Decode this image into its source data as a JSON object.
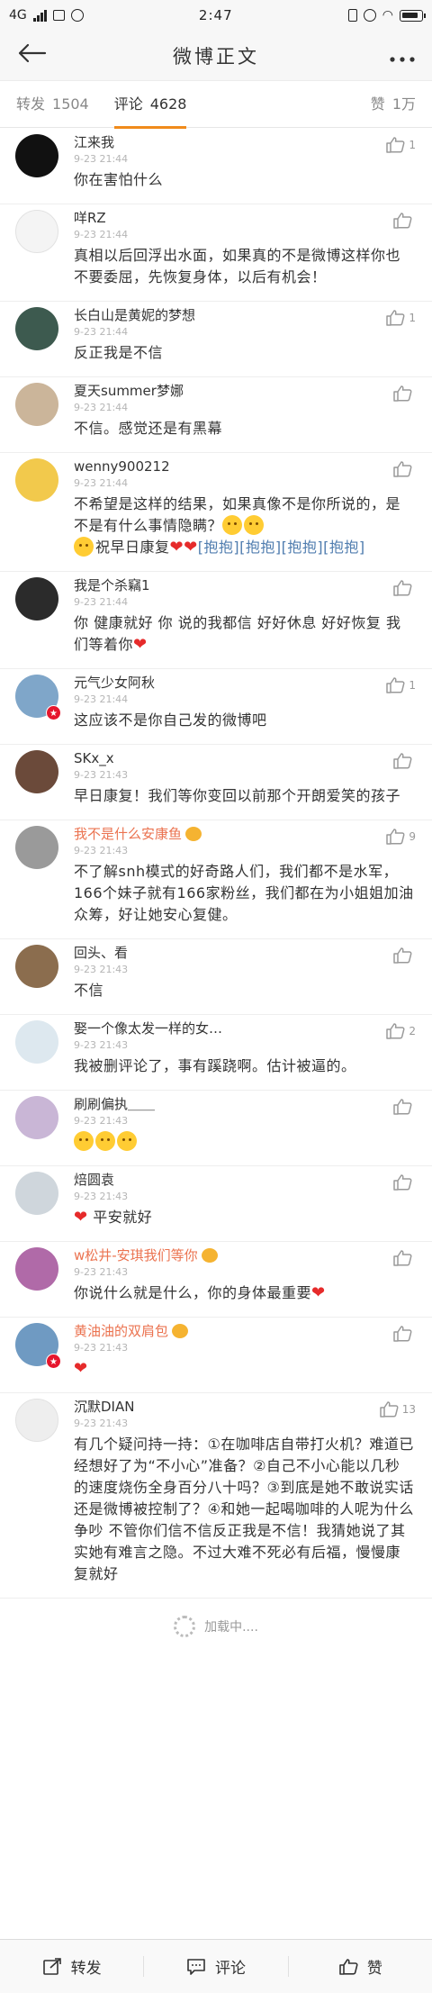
{
  "status_bar": {
    "network": "4G",
    "signal_text": "ıl",
    "time": "2:47",
    "battery": ""
  },
  "navbar": {
    "title": "微博正文"
  },
  "tabs": {
    "repost_label": "转发",
    "repost_count": "1504",
    "comment_label": "评论",
    "comment_count": "4628",
    "like_label": "赞",
    "like_count": "1万"
  },
  "comments": [
    {
      "name": "江来我",
      "time": "9-23 21:44",
      "text": "你在害怕什么",
      "likes": "1",
      "avatar_color": "#111111",
      "vip": false
    },
    {
      "name": "咩RZ",
      "time": "9-23 21:44",
      "text": "真相以后回浮出水面，如果真的不是微博这样你也不要委屈，先恢复身体，以后有机会！",
      "likes": "",
      "avatar_color": "#f4f4f4",
      "vip": false
    },
    {
      "name": "长白山是黄妮的梦想",
      "time": "9-23 21:44",
      "text": "反正我是不信",
      "likes": "1",
      "avatar_color": "#3d5a4f",
      "vip": false
    },
    {
      "name": "夏天summer梦娜",
      "time": "9-23 21:44",
      "text": "不信。感觉还是有黑幕",
      "likes": "",
      "avatar_color": "#cbb59a",
      "vip": false
    },
    {
      "name": "wenny900212",
      "time": "9-23 21:44",
      "text": "不希望是这样的结果，如果真像不是你所说的，是不是有什么事情隐瞒？",
      "text2": "祝早日康复",
      "text3": "[抱抱][抱抱][抱抱][抱抱]",
      "likes": "",
      "avatar_color": "#f2c94c",
      "vip": false
    },
    {
      "name": "我是个杀竊1",
      "time": "9-23 21:44",
      "text": "你 健康就好 你 说的我都信 好好休息 好好恢复 我们等着你",
      "likes": "",
      "avatar_color": "#2b2b2b",
      "vip": false
    },
    {
      "name": "元气少女阿秋",
      "time": "9-23 21:44",
      "text": "这应该不是你自己发的微博吧",
      "likes": "1",
      "avatar_color": "#7fa6c9",
      "vip": false,
      "badge": true
    },
    {
      "name": "SKx_x",
      "time": "9-23 21:43",
      "text": "早日康复！我们等你变回以前那个开朗爱笑的孩子",
      "likes": "",
      "avatar_color": "#6b4a3a",
      "vip": false
    },
    {
      "name": "我不是什么安康鱼",
      "time": "9-23 21:43",
      "text": "不了解snh模式的好奇路人们，我们都不是水军，166个妹子就有166家粉丝，我们都在为小姐姐加油众筹，好让她安心复健。",
      "likes": "9",
      "avatar_color": "#9a9a9a",
      "vip": true
    },
    {
      "name": "回头、看",
      "time": "9-23 21:43",
      "text": "不信",
      "likes": "",
      "avatar_color": "#8b6d4e",
      "vip": false
    },
    {
      "name": "娶一个像太发一样的女…",
      "time": "9-23 21:43",
      "text": "我被删评论了，事有蹊跷啊。估计被逼的。",
      "likes": "2",
      "avatar_color": "#dde8ef",
      "vip": false
    },
    {
      "name": "刷刷偏执＿＿",
      "time": "9-23 21:43",
      "text": "",
      "likes": "",
      "avatar_color": "#c9b6d6",
      "vip": false,
      "emojis": 3
    },
    {
      "name": "焙圆袁",
      "time": "9-23 21:43",
      "text": "平安就好",
      "likes": "",
      "avatar_color": "#cfd6dc",
      "vip": false,
      "heart_first": true
    },
    {
      "name": "w松井-安琪我们等你",
      "time": "9-23 21:43",
      "text": "你说什么就是什么，你的身体最重要",
      "likes": "",
      "avatar_color": "#b06aa8",
      "vip": true,
      "heart_last": true
    },
    {
      "name": "黄油油的双肩包",
      "time": "9-23 21:43",
      "text": "",
      "likes": "",
      "avatar_color": "#6f9ac2",
      "vip": true,
      "heart_only": true,
      "badge": true
    },
    {
      "name": "沉默DIAN",
      "time": "9-23 21:43",
      "text": "有几个疑问持一持：①在咖啡店自带打火机？难道已经想好了为“不小心”准备？②自己不小心能以几秒的速度烧伤全身百分八十吗？③到底是她不敢说实话还是微博被控制了？④和她一起喝咖啡的人呢为什么争吵 不管你们信不信反正我是不信！我猜她说了其实她有难言之隐。不过大难不死必有后福，慢慢康复就好",
      "likes": "13",
      "avatar_color": "#eeeeee",
      "vip": false
    }
  ],
  "loading_text": "加载中....",
  "toolbar": {
    "repost_label": "转发",
    "comment_label": "评论",
    "like_label": "赞"
  },
  "colors": {
    "accent": "#f08b1b",
    "vip_name": "#eb7350",
    "heart": "#e62b2b"
  }
}
